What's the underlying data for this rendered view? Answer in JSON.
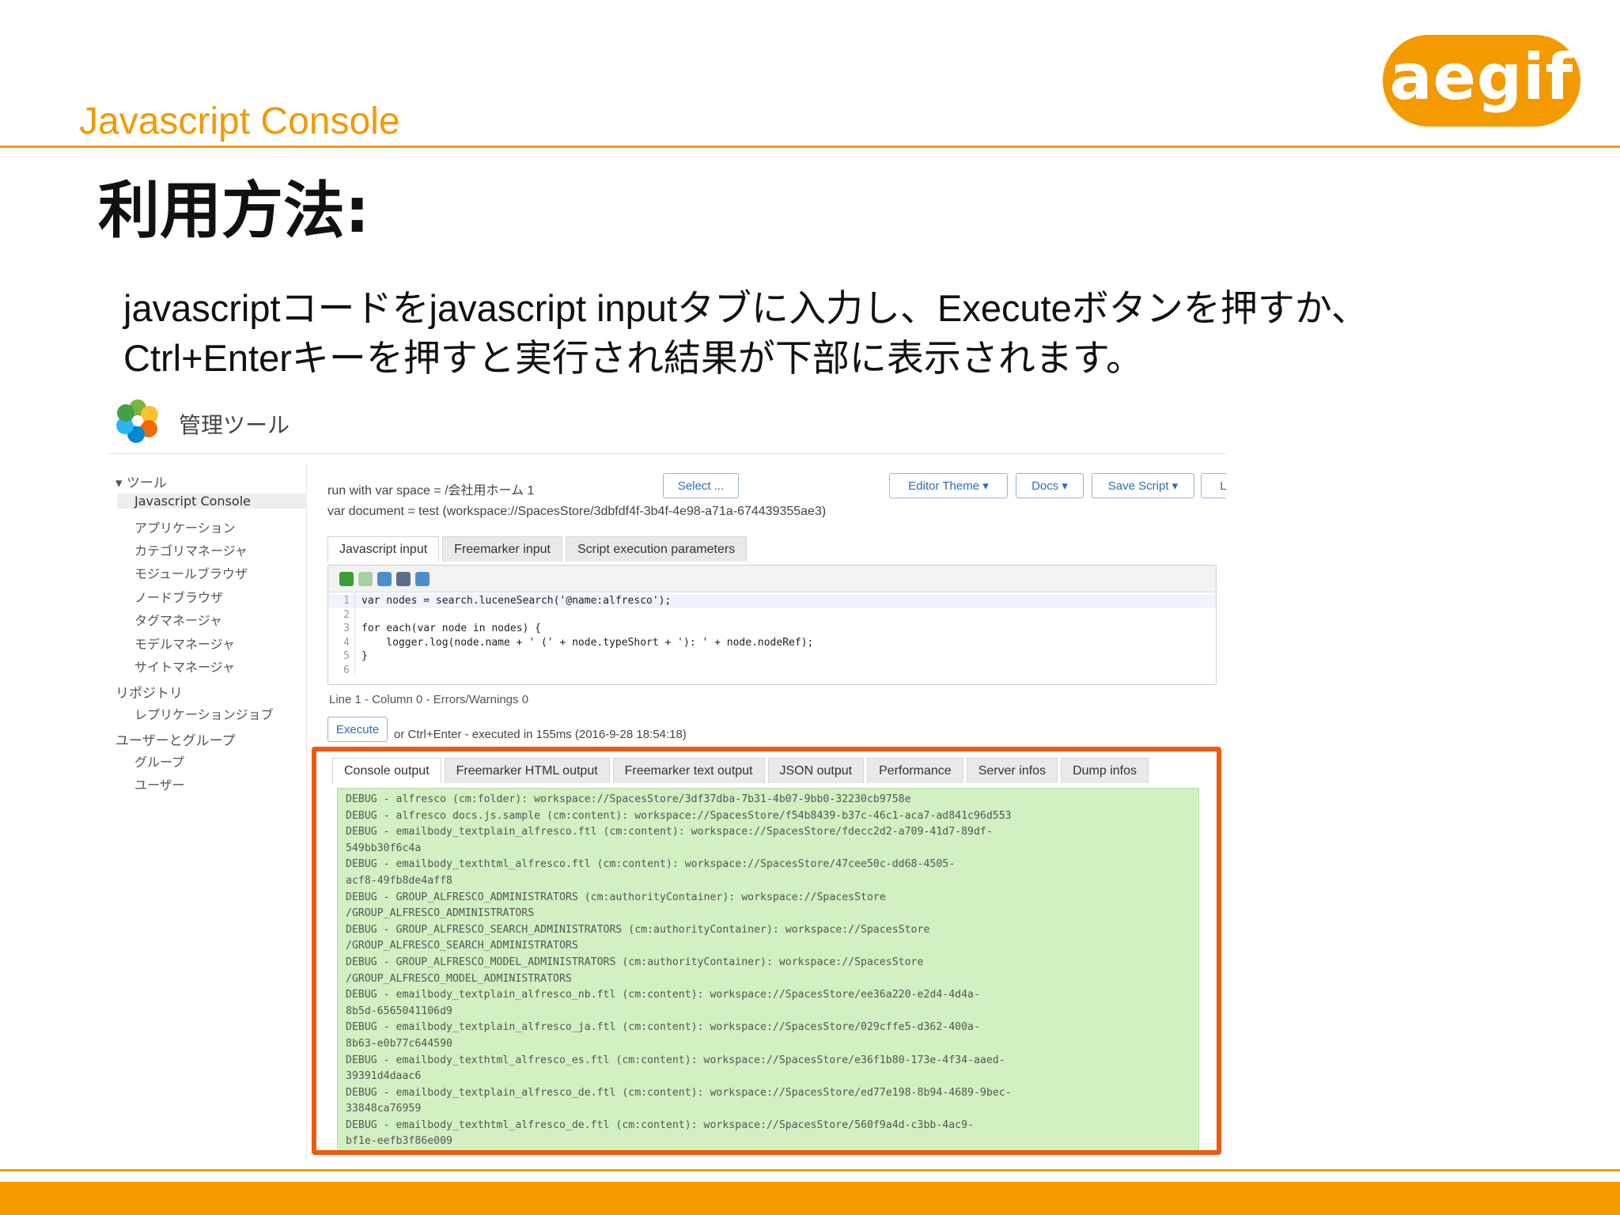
{
  "slide": {
    "logo": "aegif",
    "section_title": "Javascript Console",
    "heading": "利用方法:",
    "description_line1": "javascriptコードをjavascript inputタブに入力し、Executeボタンを押すか、",
    "description_line2": "Ctrl+Enterキーを押すと実行され結果が下部に表示されます。"
  },
  "app": {
    "title": "管理ツール",
    "sidebar": {
      "groups": [
        {
          "label": "▾ ツール",
          "items": [
            "Javascript Console",
            "アプリケーション",
            "カテゴリマネージャ",
            "モジュールブラウザ",
            "ノードブラウザ",
            "タグマネージャ",
            "モデルマネージャ",
            "サイトマネージャ"
          ]
        },
        {
          "label": "リポジトリ",
          "items": [
            "レプリケーションジョブ"
          ]
        },
        {
          "label": "ユーザーとグループ",
          "items": [
            "グループ",
            "ユーザー"
          ]
        }
      ],
      "active_item": "Javascript Console"
    },
    "runwith_text": "run with var space = /会社用ホーム 1",
    "vardoc_text": "var document = test (workspace://SpacesStore/3dbfdf4f-3b4f-4e98-a71a-674439355ae3)",
    "buttons": {
      "select": "Select ...",
      "editor_theme": "Editor Theme ▾",
      "docs": "Docs ▾",
      "save_script": "Save Script ▾",
      "load_script": "Load Script ▾",
      "execute": "Execute"
    },
    "input_tabs": [
      "Javascript input",
      "Freemarker input",
      "Script execution parameters"
    ],
    "code": [
      "var nodes = search.luceneSearch('@name:alfresco');",
      "",
      "for each(var node in nodes) {",
      "    logger.log(node.name + ' (' + node.typeShort + '): ' + node.nodeRef);",
      "}",
      ""
    ],
    "status_line": "Line 1 - Column 0 - Errors/Warnings 0",
    "execution_note": "or Ctrl+Enter - executed in 155ms (2016-9-28 18:54:18)",
    "output_tabs": [
      "Console output",
      "Freemarker HTML output",
      "Freemarker text output",
      "JSON output",
      "Performance",
      "Server infos",
      "Dump infos"
    ],
    "console_output": [
      "DEBUG - alfresco (cm:folder): workspace://SpacesStore/3df37dba-7b31-4b07-9bb0-32230cb9758e",
      "DEBUG - alfresco docs.js.sample (cm:content): workspace://SpacesStore/f54b8439-b37c-46c1-aca7-ad841c96d553",
      "DEBUG - emailbody_textplain_alfresco.ftl (cm:content): workspace://SpacesStore/fdecc2d2-a709-41d7-89df-",
      "549bb30f6c4a",
      "DEBUG - emailbody_texthtml_alfresco.ftl (cm:content): workspace://SpacesStore/47cee50c-dd68-4505-",
      "acf8-49fb8de4aff8",
      "DEBUG - GROUP_ALFRESCO_ADMINISTRATORS (cm:authorityContainer): workspace://SpacesStore",
      "/GROUP_ALFRESCO_ADMINISTRATORS",
      "DEBUG - GROUP_ALFRESCO_SEARCH_ADMINISTRATORS (cm:authorityContainer): workspace://SpacesStore",
      "/GROUP_ALFRESCO_SEARCH_ADMINISTRATORS",
      "DEBUG - GROUP_ALFRESCO_MODEL_ADMINISTRATORS (cm:authorityContainer): workspace://SpacesStore",
      "/GROUP_ALFRESCO_MODEL_ADMINISTRATORS",
      "DEBUG - emailbody_textplain_alfresco_nb.ftl (cm:content): workspace://SpacesStore/ee36a220-e2d4-4d4a-",
      "8b5d-6565041106d9",
      "DEBUG - emailbody_textplain_alfresco_ja.ftl (cm:content): workspace://SpacesStore/029cffe5-d362-400a-",
      "8b63-e0b77c644590",
      "DEBUG - emailbody_texthtml_alfresco_es.ftl (cm:content): workspace://SpacesStore/e36f1b80-173e-4f34-aaed-",
      "39391d4daac6",
      "DEBUG - emailbody_textplain_alfresco_de.ftl (cm:content): workspace://SpacesStore/ed77e198-8b94-4689-9bec-",
      "33848ca76959",
      "DEBUG - emailbody_texthtml_alfresco_de.ftl (cm:content): workspace://SpacesStore/560f9a4d-c3bb-4ac9-",
      "bf1e-eefb3f86e009"
    ]
  },
  "colors": {
    "accent_orange": "#f39a00",
    "highlight_border": "#ec5a0f",
    "console_bg": "#d2f0c2",
    "button_text": "#2d6fb3"
  }
}
